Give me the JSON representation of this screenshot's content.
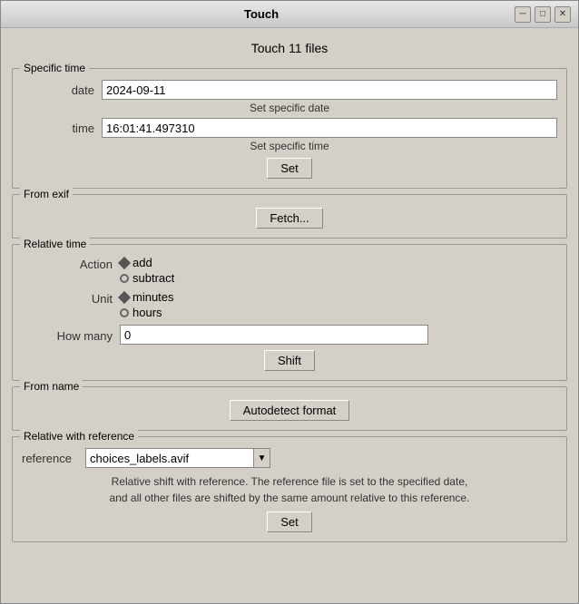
{
  "window": {
    "title": "Touch",
    "minimize_label": "─",
    "maximize_label": "□",
    "close_label": "✕"
  },
  "main_title": "Touch 11 files",
  "specific_time": {
    "group_label": "Specific time",
    "date_label": "date",
    "date_value": "2024-09-11",
    "date_hint": "Set specific date",
    "time_label": "time",
    "time_value": "16:01:41.497310",
    "time_hint": "Set specific time",
    "set_button": "Set"
  },
  "from_exif": {
    "group_label": "From exif",
    "fetch_button": "Fetch..."
  },
  "relative_time": {
    "group_label": "Relative time",
    "action_label": "Action",
    "add_label": "add",
    "subtract_label": "subtract",
    "unit_label": "Unit",
    "minutes_label": "minutes",
    "hours_label": "hours",
    "how_many_label": "How many",
    "how_many_value": "0",
    "shift_button": "Shift"
  },
  "from_name": {
    "group_label": "From name",
    "autodetect_button": "Autodetect format"
  },
  "relative_with_reference": {
    "group_label": "Relative with reference",
    "reference_label": "reference",
    "reference_value": "choices_labels.avif",
    "description": "Relative shift with reference. The reference file is set to the specified date,\nand all other files are shifted by the same amount relative to this reference.",
    "set_button": "Set"
  }
}
